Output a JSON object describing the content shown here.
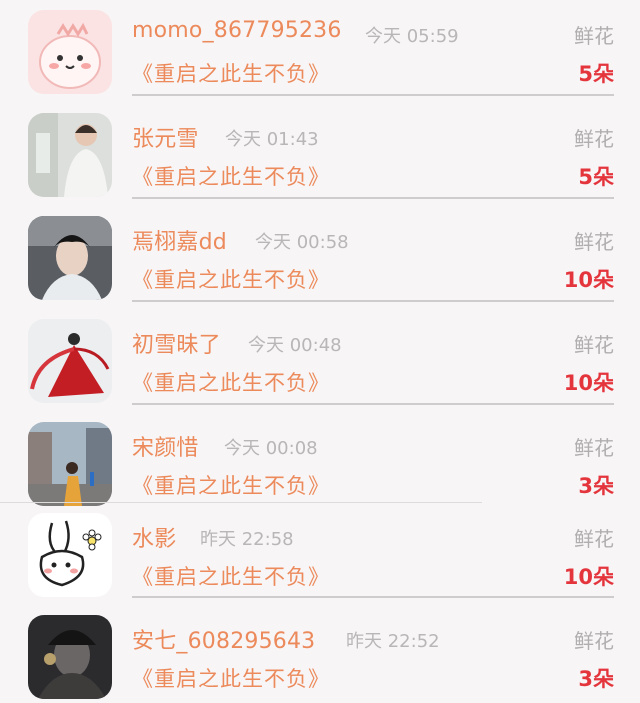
{
  "rows": [
    {
      "name": "momo_867795236",
      "time": "今天 05:59",
      "gift": "鲜花",
      "book": "《重启之此生不负》",
      "count": "5朵",
      "avatar_icon": "cute-blob-avatar-icon"
    },
    {
      "name": "张元雪",
      "time": "今天 01:43",
      "gift": "鲜花",
      "book": "《重启之此生不负》",
      "count": "5朵",
      "avatar_icon": "man-in-white-shirt-avatar-icon"
    },
    {
      "name": "焉栩嘉dd",
      "time": "今天 00:58",
      "gift": "鲜花",
      "book": "《重启之此生不负》",
      "count": "10朵",
      "avatar_icon": "portrait-man-avatar-icon"
    },
    {
      "name": "初雪昧了",
      "time": "今天 00:48",
      "gift": "鲜花",
      "book": "《重启之此生不负》",
      "count": "10朵",
      "avatar_icon": "woman-red-dress-avatar-icon"
    },
    {
      "name": "宋颜惜",
      "time": "今天 00:08",
      "gift": "鲜花",
      "book": "《重启之此生不负》",
      "count": "3朵",
      "avatar_icon": "street-photo-avatar-icon"
    },
    {
      "name": "水影",
      "time": "昨天 22:58",
      "gift": "鲜花",
      "book": "《重启之此生不负》",
      "count": "10朵",
      "avatar_icon": "rabbit-doodle-avatar-icon"
    },
    {
      "name": "安七_608295643",
      "time": "昨天 22:52",
      "gift": "鲜花",
      "book": "《重启之此生不负》",
      "count": "3朵",
      "avatar_icon": "dark-costume-avatar-icon"
    }
  ],
  "colors": {
    "name": "#ec8a5b",
    "count": "#e4353d",
    "muted": "#b0aeae",
    "background": "#f7f5f6"
  }
}
